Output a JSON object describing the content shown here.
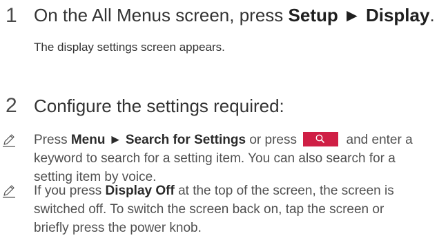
{
  "steps": [
    {
      "number": "1",
      "text_prefix": "On the All Menus screen, press ",
      "bold_1": "Setup",
      "arrow": " ► ",
      "bold_2": "Display",
      "text_suffix": ".",
      "description": "The display settings screen appears."
    },
    {
      "number": "2",
      "text": "Configure the settings required:"
    }
  ],
  "notes": [
    {
      "icon": "pencil-note-icon",
      "line1_prefix": "Press ",
      "line1_bold": "Menu ► Search for Settings",
      "line1_mid": " or press ",
      "line1_suffix": " and enter a",
      "line2": "keyword to search for a setting item. You can also search for a",
      "line3": "setting item by voice."
    },
    {
      "icon": "pencil-note-icon",
      "line1_prefix": "If you press ",
      "line1_bold": "Display Off",
      "line1_suffix": " at the top of the screen, the screen is",
      "line2": "switched off. To switch the screen back on, tap the screen or",
      "line3": "briefly press the power knob."
    }
  ],
  "colors": {
    "search_button": "#cf1f45"
  }
}
